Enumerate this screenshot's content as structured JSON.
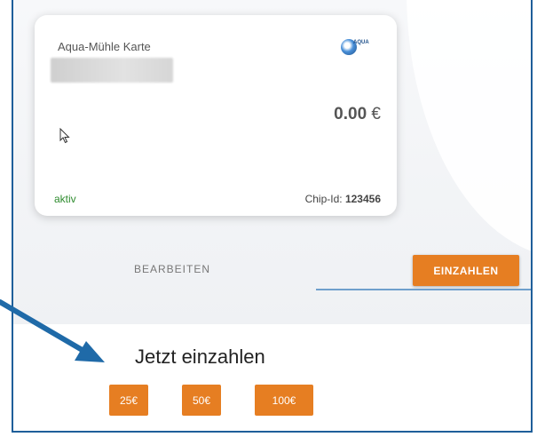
{
  "card": {
    "title": "Aqua-Mühle Karte",
    "logo_text": "AQUA",
    "balance_value": "0.00",
    "balance_currency": "€",
    "status": "aktiv",
    "chip_label": "Chip-Id:",
    "chip_id": "123456"
  },
  "actions": {
    "edit_label": "BEARBEITEN",
    "deposit_label": "EINZAHLEN"
  },
  "deposit": {
    "heading": "Jetzt einzahlen",
    "amounts": [
      "25€",
      "50€",
      "100€"
    ]
  },
  "colors": {
    "accent": "#e67e22",
    "status_green": "#2e8b2e",
    "arrow_blue": "#1f6aa8",
    "frame_border": "#1f5f9a"
  },
  "icons": [
    "mouse-cursor-icon",
    "aqua-logo-icon",
    "annotation-arrow-icon"
  ]
}
